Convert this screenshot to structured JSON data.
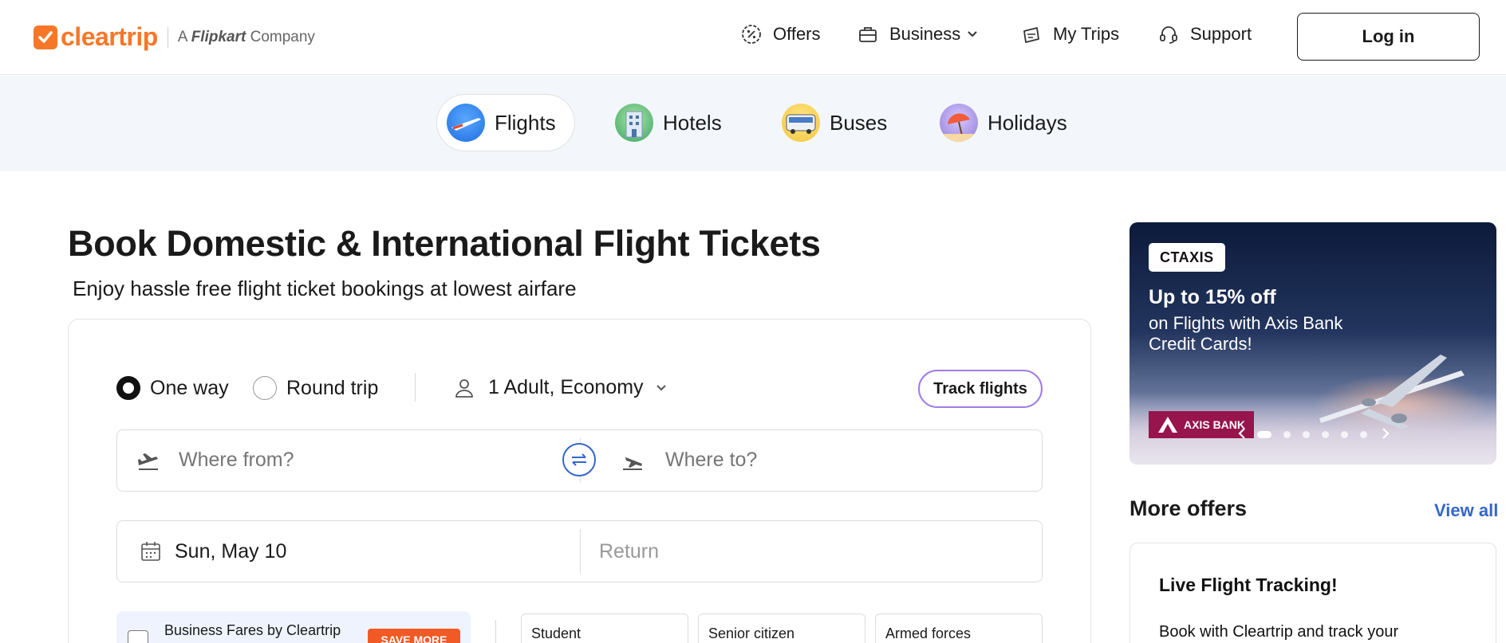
{
  "header": {
    "logo_text": "cleartrip",
    "tagline_a": "A",
    "tagline_brand": "Flipkart",
    "tagline_rest": "Company",
    "nav": [
      {
        "label": "Offers",
        "icon": "offers-icon"
      },
      {
        "label": "Business",
        "icon": "briefcase-icon"
      },
      {
        "label": "My Trips",
        "icon": "trips-icon"
      },
      {
        "label": "Support",
        "icon": "headset-icon"
      }
    ],
    "login_label": "Log in"
  },
  "categories": [
    {
      "label": "Flights",
      "icon": "flight-icon",
      "active": true
    },
    {
      "label": "Hotels",
      "icon": "hotel-icon",
      "active": false
    },
    {
      "label": "Buses",
      "icon": "bus-icon",
      "active": false
    },
    {
      "label": "Holidays",
      "icon": "beach-umbrella-icon",
      "active": false
    }
  ],
  "main": {
    "title": "Book Domestic & International Flight Tickets",
    "subtitle": "Enjoy hassle free flight ticket bookings at lowest airfare"
  },
  "search": {
    "trip_types": [
      {
        "label": "One way",
        "selected": true
      },
      {
        "label": "Round trip",
        "selected": false
      }
    ],
    "passengers": "1 Adult, Economy",
    "track_label": "Track flights",
    "from_placeholder": "Where from?",
    "to_placeholder": "Where to?",
    "depart_value": "Sun, May 10",
    "return_placeholder": "Return",
    "business_fares": "Business Fares by Cleartrip",
    "business_badge": "SAVE MORE",
    "special_fares": [
      "Student",
      "Senior citizen",
      "Armed forces"
    ]
  },
  "promo": {
    "code": "CTAXIS",
    "headline": "Up to 15% off",
    "details": "on Flights with Axis Bank Credit Cards!",
    "bank_label": "AXIS BANK",
    "accent": "#97144d"
  },
  "offers": {
    "heading": "More offers",
    "view_all": "View all",
    "card_title": "Live Flight Tracking!",
    "card_text": "Book with Cleartrip and track your"
  },
  "colors": {
    "brand": "#f77728",
    "link": "#3366cc",
    "badge": "#f15a24"
  }
}
